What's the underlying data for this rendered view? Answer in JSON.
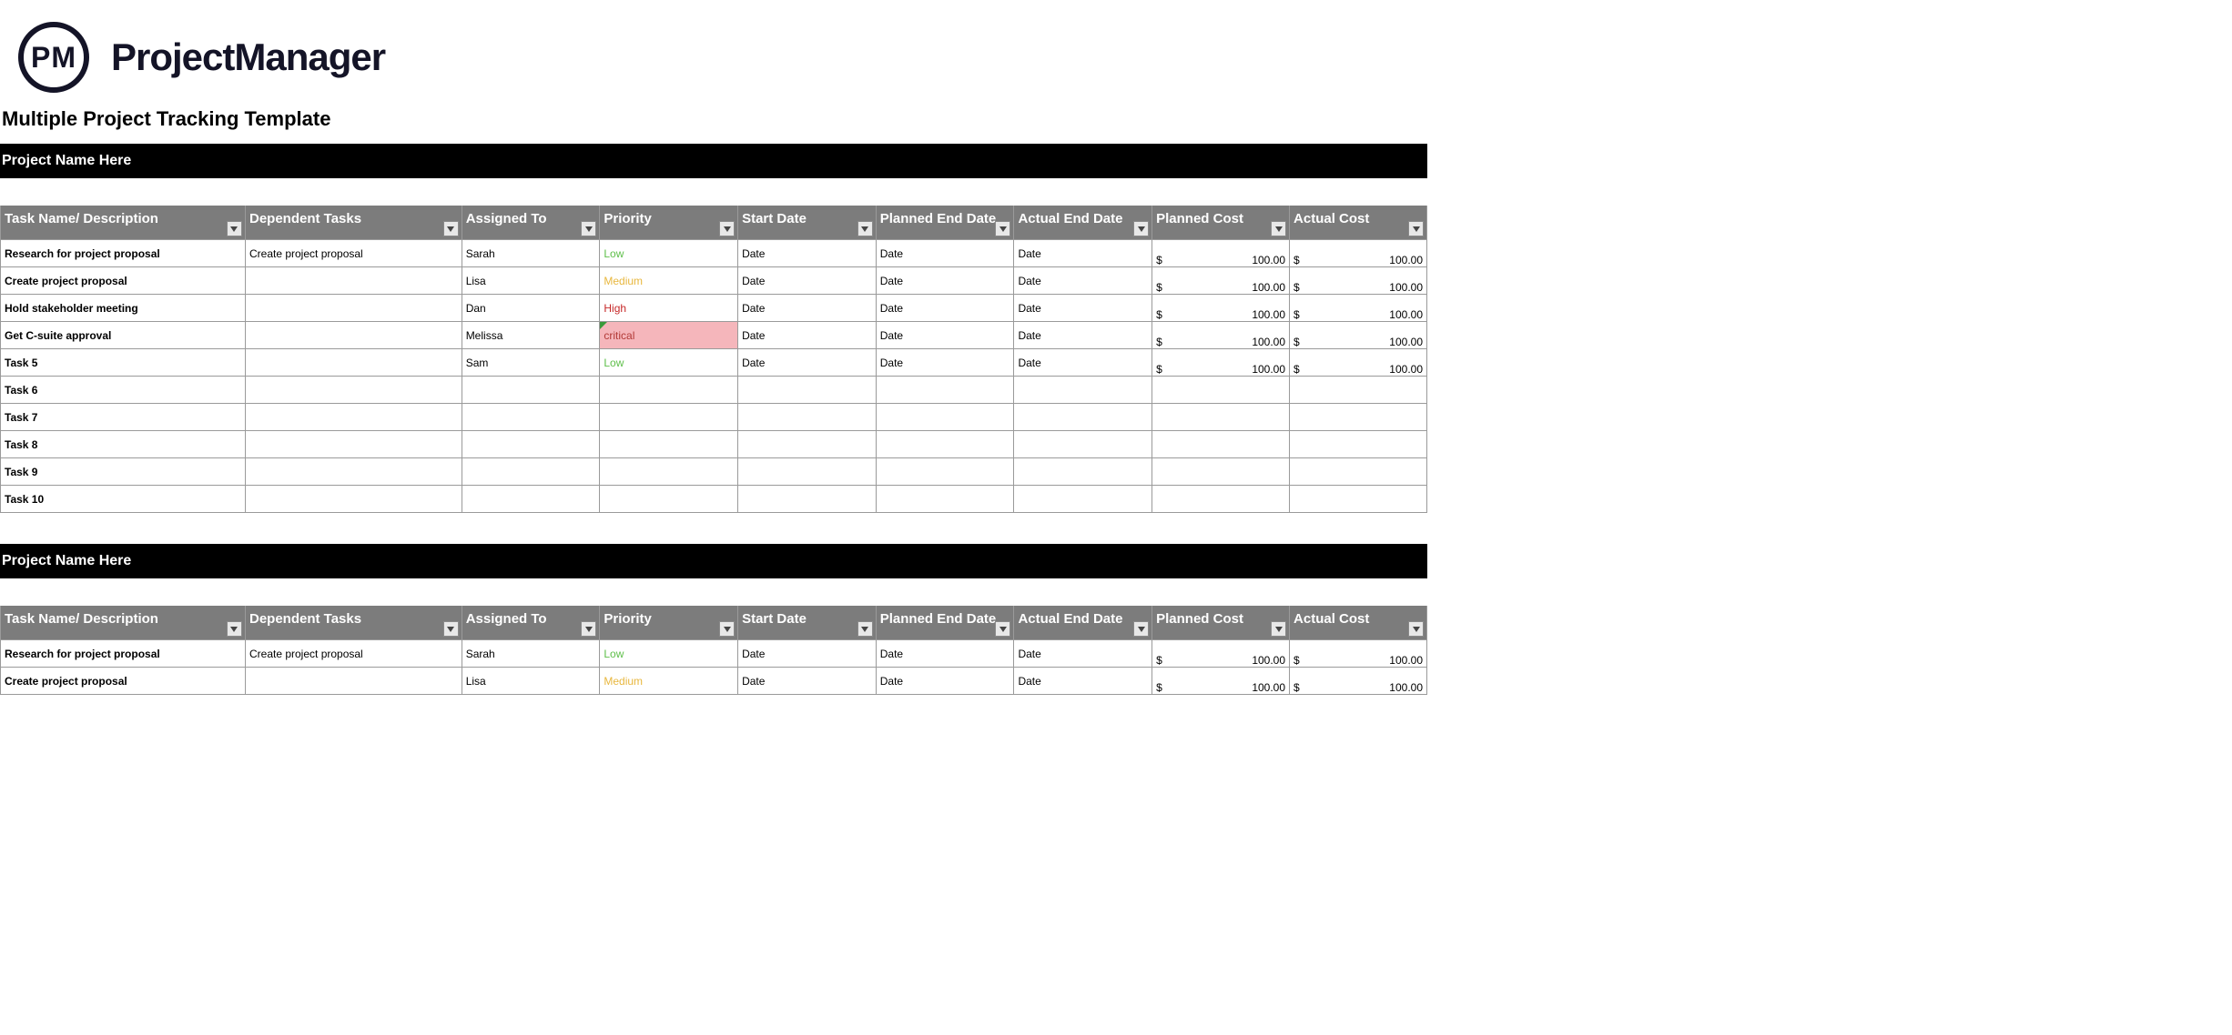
{
  "brand": {
    "logo_text": "PM",
    "name": "ProjectManager"
  },
  "page_title": "Multiple Project Tracking Template",
  "project_label": "Project Name Here",
  "cols": {
    "task": "Task Name/ Description",
    "dep": "Dependent Tasks",
    "asg": "Assigned To",
    "pri": "Priority",
    "sdt": "Start Date",
    "ped": "Planned End Date",
    "aed": "Actual End Date",
    "pc": "Planned Cost",
    "ac": "Actual Cost"
  },
  "currency": "$",
  "rows": [
    {
      "task": "Research for project proposal",
      "dep": "Create project proposal",
      "asg": "Sarah",
      "pri": "Low",
      "sdt": "Date",
      "ped": "Date",
      "aed": "Date",
      "pc": "100.00",
      "ac": "100.00"
    },
    {
      "task": "Create project proposal",
      "dep": "",
      "asg": "Lisa",
      "pri": "Medium",
      "sdt": "Date",
      "ped": "Date",
      "aed": "Date",
      "pc": "100.00",
      "ac": "100.00"
    },
    {
      "task": "Hold stakeholder meeting",
      "dep": "",
      "asg": "Dan",
      "pri": "High",
      "sdt": "Date",
      "ped": "Date",
      "aed": "Date",
      "pc": "100.00",
      "ac": "100.00"
    },
    {
      "task": "Get C-suite approval",
      "dep": "",
      "asg": "Melissa",
      "pri": "critical",
      "sdt": "Date",
      "ped": "Date",
      "aed": "Date",
      "pc": "100.00",
      "ac": "100.00"
    },
    {
      "task": "Task 5",
      "dep": "",
      "asg": "Sam",
      "pri": "Low",
      "sdt": "Date",
      "ped": "Date",
      "aed": "Date",
      "pc": "100.00",
      "ac": "100.00"
    },
    {
      "task": "Task 6"
    },
    {
      "task": "Task 7"
    },
    {
      "task": "Task 8"
    },
    {
      "task": "Task 9"
    },
    {
      "task": "Task 10"
    }
  ],
  "rows2": [
    {
      "task": "Research for project proposal",
      "dep": "Create project proposal",
      "asg": "Sarah",
      "pri": "Low",
      "sdt": "Date",
      "ped": "Date",
      "aed": "Date",
      "pc": "100.00",
      "ac": "100.00"
    },
    {
      "task": "Create project proposal",
      "dep": "",
      "asg": "Lisa",
      "pri": "Medium",
      "sdt": "Date",
      "ped": "Date",
      "aed": "Date",
      "pc": "100.00",
      "ac": "100.00"
    }
  ]
}
